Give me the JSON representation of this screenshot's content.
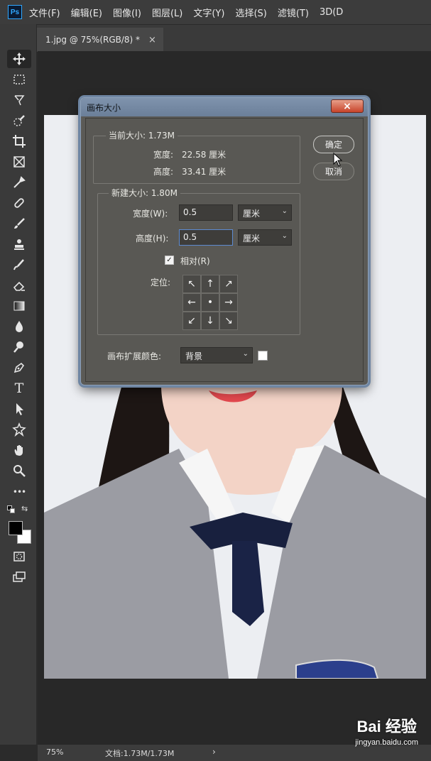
{
  "app": {
    "logo": "Ps"
  },
  "menu": [
    "文件(F)",
    "编辑(E)",
    "图像(I)",
    "图层(L)",
    "文字(Y)",
    "选择(S)",
    "滤镜(T)",
    "3D(D"
  ],
  "tab": {
    "title": "1.jpg @ 75%(RGB/8) *",
    "close": "×"
  },
  "tools": [
    "move-tool-icon",
    "marquee-tool-icon",
    "lasso-tool-icon",
    "quick-select-tool-icon",
    "crop-tool-icon",
    "frame-tool-icon",
    "eyedropper-tool-icon",
    "healing-brush-icon",
    "brush-tool-icon",
    "stamp-tool-icon",
    "history-brush-icon",
    "eraser-tool-icon",
    "gradient-tool-icon",
    "blur-tool-icon",
    "dodge-tool-icon",
    "pen-tool-icon",
    "type-tool-icon",
    "path-select-icon",
    "shape-tool-icon",
    "hand-tool-icon",
    "zoom-tool-icon",
    "more-tools-icon"
  ],
  "tool_glyphs": {
    "type": "T",
    "more": "•••"
  },
  "colors": {
    "foreground": "#000000",
    "background": "#ffffff"
  },
  "dialog": {
    "title": "画布大小",
    "close": "×",
    "current_size": {
      "legend": "当前大小: 1.73M",
      "width_label": "宽度:",
      "width_value": "22.58 厘米",
      "height_label": "高度:",
      "height_value": "33.41 厘米"
    },
    "new_size": {
      "legend": "新建大小: 1.80M",
      "width_label": "宽度(W):",
      "width_value": "0.5",
      "width_unit": "厘米",
      "height_label": "高度(H):",
      "height_value": "0.5",
      "height_unit": "厘米",
      "relative_label": "相对(R)",
      "relative_checked": true,
      "anchor_label": "定位:",
      "anchor_arrows": [
        "↖",
        "↑",
        "↗",
        "←",
        "•",
        "→",
        "↙",
        "↓",
        "↘"
      ]
    },
    "extension_color_label": "画布扩展颜色:",
    "extension_color_value": "背景",
    "extension_color_swatch": "#ffffff",
    "ok": "确定",
    "cancel": "取消"
  },
  "status": {
    "zoom": "75%",
    "doc_info": "文档:1.73M/1.73M",
    "arrow": "›"
  },
  "watermark": {
    "main": "Bai 经验",
    "sub": "jingyan.baidu.com"
  }
}
